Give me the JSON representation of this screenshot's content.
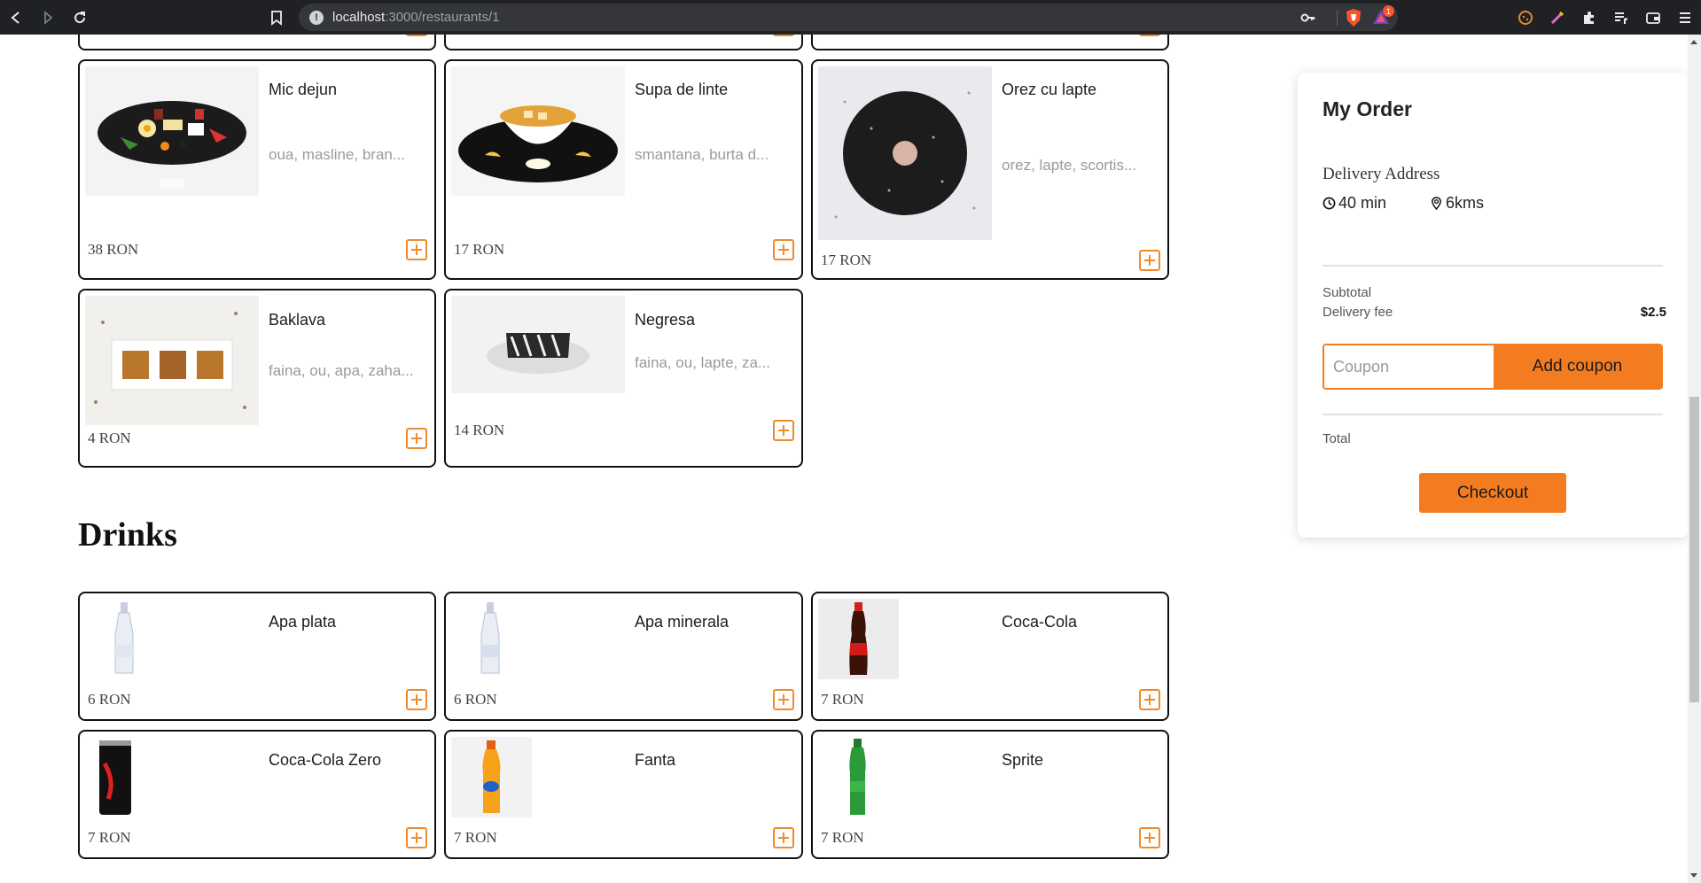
{
  "browser": {
    "url_host": "localhost",
    "url_path": ":3000/restaurants/1",
    "rewards_badge": "1"
  },
  "menu": {
    "desserts": [
      {
        "name": "Mic dejun",
        "desc": "oua, masline, bran...",
        "price": "38 RON",
        "image": "breakfast-platter-image"
      },
      {
        "name": "Supa de linte",
        "desc": "smantana, burta d...",
        "price": "17 RON",
        "image": "lentil-soup-image"
      },
      {
        "name": "Orez cu lapte",
        "desc": "orez, lapte, scortis...",
        "price": "17 RON",
        "image": "rice-pudding-image"
      },
      {
        "name": "Baklava",
        "desc": "faina, ou, apa, zaha...",
        "price": "4 RON",
        "image": "baklava-image"
      },
      {
        "name": "Negresa",
        "desc": "faina, ou, lapte, za...",
        "price": "14 RON",
        "image": "negresa-cake-image"
      }
    ],
    "drinks_title": "Drinks",
    "drinks": [
      {
        "name": "Apa plata",
        "price": "6 RON",
        "image": "still-water-bottle-image"
      },
      {
        "name": "Apa minerala",
        "price": "6 RON",
        "image": "mineral-water-bottle-image"
      },
      {
        "name": "Coca-Cola",
        "price": "7 RON",
        "image": "coca-cola-bottle-image"
      },
      {
        "name": "Coca-Cola Zero",
        "price": "7 RON",
        "image": "coca-cola-zero-can-image"
      },
      {
        "name": "Fanta",
        "price": "7 RON",
        "image": "fanta-bottle-image"
      },
      {
        "name": "Sprite",
        "price": "7 RON",
        "image": "sprite-bottle-image"
      }
    ]
  },
  "order": {
    "title": "My Order",
    "address_label": "Delivery Address",
    "time": "40 min",
    "distance": "6kms",
    "subtotal_label": "Subtotal",
    "delivery_fee_label": "Delivery fee",
    "delivery_fee_value": "$2.5",
    "coupon_placeholder": "Coupon",
    "add_coupon_label": "Add coupon",
    "total_label": "Total",
    "checkout_label": "Checkout"
  },
  "colors": {
    "accent": "#f47c20",
    "card_border": "#111111",
    "chrome_bg": "#202124"
  }
}
